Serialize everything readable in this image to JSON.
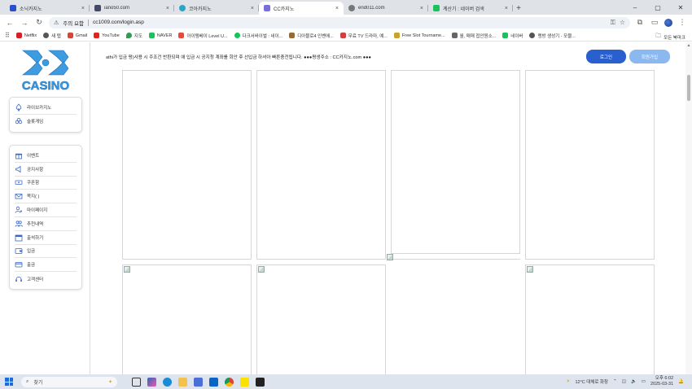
{
  "browser": {
    "tabs": [
      {
        "title": "소닉카지노",
        "color": "#2b4fc9"
      },
      {
        "title": "iano50.com",
        "color": "#444a66"
      },
      {
        "title": "코아카지노",
        "color": "#2aa7c4"
      },
      {
        "title": "CC카지노",
        "color": "#7a6fd8",
        "active": true
      },
      {
        "title": "end011.com",
        "color": "#777777"
      },
      {
        "title": "계산기 : 네이버 검색",
        "color": "#19c25a"
      }
    ],
    "address": {
      "security_label": "주의 요함",
      "url": "cc1009.com/login.asp"
    },
    "bookmarks": [
      {
        "label": "Netflix",
        "color": "#d81f26"
      },
      {
        "label": "새 탭",
        "color": "#555555"
      },
      {
        "label": "Gmail",
        "color": "#d64537"
      },
      {
        "label": "YouTube",
        "color": "#e62117"
      },
      {
        "label": "지도",
        "color": "#2f9d52"
      },
      {
        "label": "NAVER",
        "color": "#19c25a"
      },
      {
        "label": "아이템베이 Level U...",
        "color": "#e84a3a"
      },
      {
        "label": "다크서바이벌 : 네이...",
        "color": "#19c25a"
      },
      {
        "label": "디아블로4 인벤에...",
        "color": "#9a6b2f"
      },
      {
        "label": "무료 TV 드라마, 예...",
        "color": "#d23f3f"
      },
      {
        "label": "Free Slot Tourname...",
        "color": "#c9a227"
      },
      {
        "label": "월, 매매 접안원소...",
        "color": "#666666"
      },
      {
        "label": "네이버",
        "color": "#19c25a"
      },
      {
        "label": "랭방 생성기 - 모블...",
        "color": "#555555"
      }
    ],
    "bookmarks_folder": "모든 북마크"
  },
  "site": {
    "logo_text": "CASINO",
    "notice": "athi가 입금 펑)사용 시 주조건 반환되며 애 입금 시 공지청 계좌를 회안 후 선입금 하셔아 빠른충전됩니다. ●●●평생주소 : CC카지노.com ●●●",
    "login_button": "로그인",
    "join_button": "회원가입",
    "menu_top": [
      {
        "label": "라이브카지노",
        "icon": "spade-icon"
      },
      {
        "label": "슬롯게임",
        "icon": "club-icon"
      }
    ],
    "menu_main": [
      {
        "label": "이벤트",
        "icon": "gift-icon"
      },
      {
        "label": "공지사항",
        "icon": "speaker-icon"
      },
      {
        "label": "쿠폰함",
        "icon": "ticket-icon"
      },
      {
        "label": "쪽지( )",
        "icon": "envelope-icon"
      },
      {
        "label": "마이페이지",
        "icon": "user-gear-icon"
      },
      {
        "label": "추천내역",
        "icon": "users-icon"
      },
      {
        "label": "출석하기",
        "icon": "calendar-icon"
      },
      {
        "label": "입금",
        "icon": "wallet-icon"
      },
      {
        "label": "출금",
        "icon": "card-icon"
      },
      {
        "label": "고객센터",
        "icon": "headset-icon"
      }
    ]
  },
  "taskbar": {
    "search_placeholder": "찾기",
    "weather": "12°C 대체로 화창",
    "time": "오후 6:02",
    "date": "2025-03-31"
  }
}
